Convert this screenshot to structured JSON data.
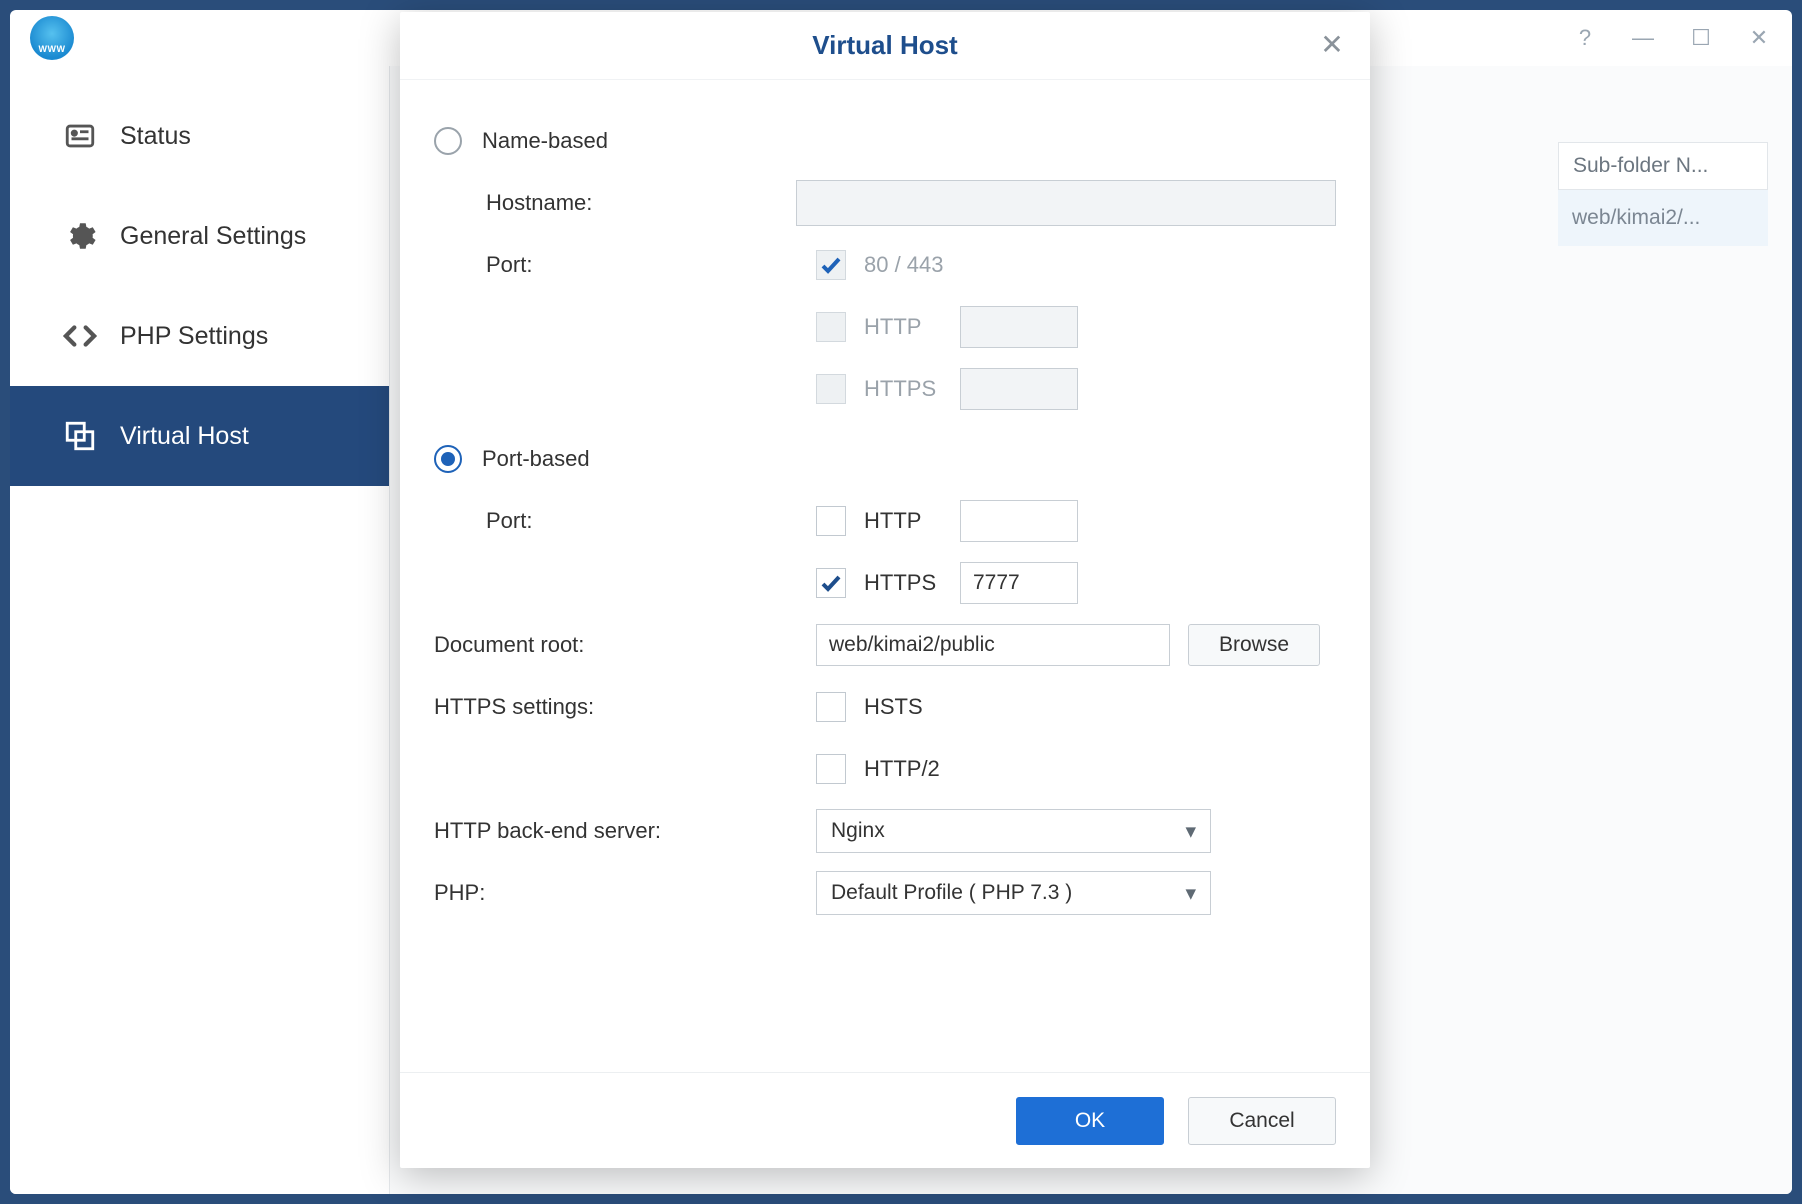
{
  "sidebar": {
    "items": [
      {
        "label": "Status"
      },
      {
        "label": "General Settings"
      },
      {
        "label": "PHP Settings"
      },
      {
        "label": "Virtual Host"
      }
    ]
  },
  "mainTable": {
    "header": "Sub-folder N...",
    "row": "web/kimai2/..."
  },
  "modal": {
    "title": "Virtual Host",
    "nameBased": {
      "radioLabel": "Name-based",
      "hostnameLabel": "Hostname:",
      "hostnameValue": "",
      "portLabel": "Port:",
      "port8043": "80 / 443",
      "httpLabel": "HTTP",
      "httpValue": "",
      "httpsLabel": "HTTPS",
      "httpsValue": ""
    },
    "portBased": {
      "radioLabel": "Port-based",
      "portLabel": "Port:",
      "httpLabel": "HTTP",
      "httpValue": "",
      "httpsLabel": "HTTPS",
      "httpsValue": "7777"
    },
    "docRootLabel": "Document root:",
    "docRootValue": "web/kimai2/public",
    "browseLabel": "Browse",
    "httpsSettingsLabel": "HTTPS settings:",
    "hstsLabel": "HSTS",
    "http2Label": "HTTP/2",
    "backendLabel": "HTTP back-end server:",
    "backendValue": "Nginx",
    "phpLabel": "PHP:",
    "phpValue": "Default Profile ( PHP 7.3 )",
    "okLabel": "OK",
    "cancelLabel": "Cancel"
  }
}
